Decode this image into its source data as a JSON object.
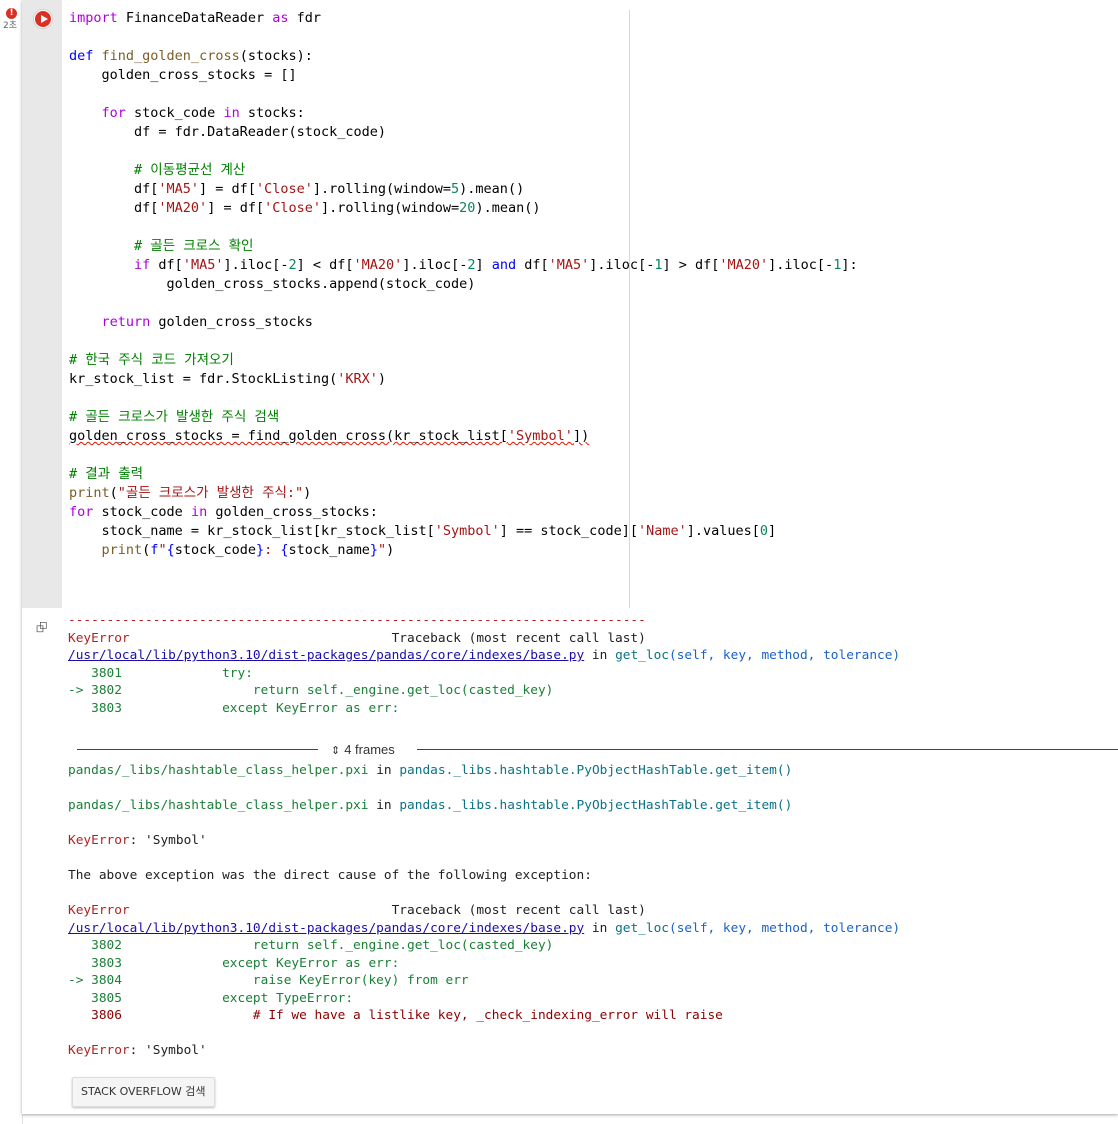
{
  "gutter": {
    "error_icon": "!",
    "exec_time": "2초"
  },
  "cell": {
    "run_button_icon": "play-icon",
    "code_lines": [
      "import FinanceDataReader as fdr",
      "",
      "def find_golden_cross(stocks):",
      "    golden_cross_stocks = []",
      "",
      "    for stock_code in stocks:",
      "        df = fdr.DataReader(stock_code)",
      "",
      "        # 이동평균선 계산",
      "        df['MA5'] = df['Close'].rolling(window=5).mean()",
      "        df['MA20'] = df['Close'].rolling(window=20).mean()",
      "",
      "        # 골든 크로스 확인",
      "        if df['MA5'].iloc[-2] < df['MA20'].iloc[-2] and df['MA5'].iloc[-1] > df['MA20'].iloc[-1]:",
      "            golden_cross_stocks.append(stock_code)",
      "",
      "    return golden_cross_stocks",
      "",
      "# 한국 주식 코드 가져오기",
      "kr_stock_list = fdr.StockListing('KRX')",
      "",
      "# 골든 크로스가 발생한 주식 검색",
      "golden_cross_stocks = find_golden_cross(kr_stock_list['Symbol'])",
      "",
      "# 결과 출력",
      "print(\"골든 크로스가 발생한 주식:\")",
      "for stock_code in golden_cross_stocks:",
      "    stock_name = kr_stock_list[kr_stock_list['Symbol'] == stock_code]['Name'].values[0]",
      "    print(f\"{stock_code}: {stock_name}\")"
    ]
  },
  "output": {
    "separator": "---------------------------------------------------------------------------",
    "error1_name": "KeyError",
    "traceback_header": "Traceback (most recent call last)",
    "file_path": "/usr/local/lib/python3.10/dist-packages/pandas/core/indexes/base.py",
    "in_word": "in",
    "func_sig": "get_loc(self, key, method, tolerance)",
    "tb1": [
      "   3801             try:",
      "-> 3802                 return self._engine.get_loc(casted_key)",
      "   3803             except KeyError as err:"
    ],
    "frames_label": "4 frames",
    "hashtable_file": "pandas/_libs/hashtable_class_helper.pxi",
    "hashtable_func": "pandas._libs.hashtable.PyObjectHashTable.get_item()",
    "key_error_msg": ": 'Symbol'",
    "cause_text": "The above exception was the direct cause of the following exception:",
    "tb2": [
      "   3802                 return self._engine.get_loc(casted_key)",
      "   3803             except KeyError as err:",
      "-> 3804                 raise KeyError(key) from err",
      "   3805             except TypeError:",
      "   3806                 # If we have a listlike key, _check_indexing_error will raise"
    ],
    "stack_overflow_button": "STACK OVERFLOW 검색"
  }
}
